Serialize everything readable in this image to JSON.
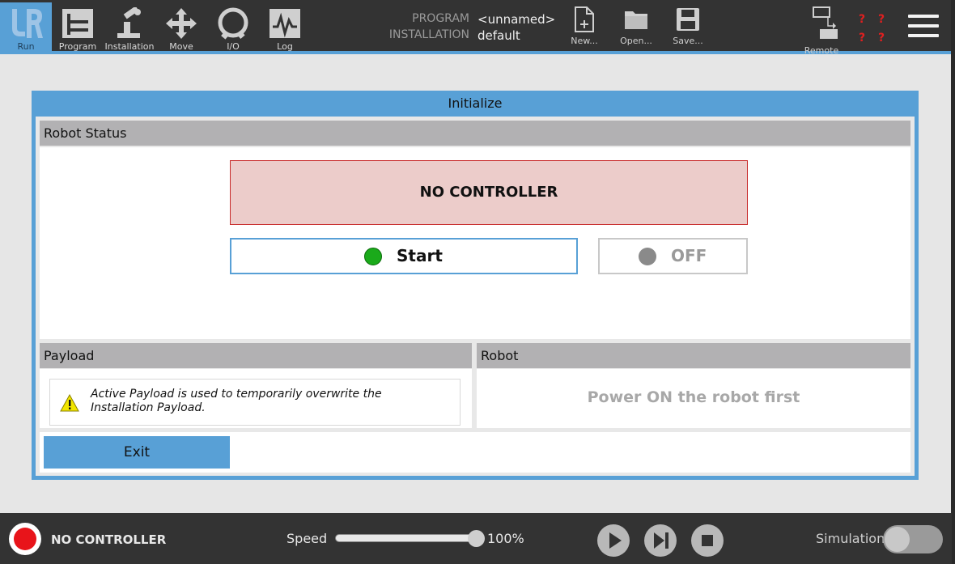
{
  "nav": {
    "items": [
      {
        "label": "Run"
      },
      {
        "label": "Program"
      },
      {
        "label": "Installation"
      },
      {
        "label": "Move"
      },
      {
        "label": "I/O"
      },
      {
        "label": "Log"
      }
    ],
    "active": "Run"
  },
  "header": {
    "program_label": "PROGRAM",
    "program_value": "<unnamed>",
    "installation_label": "INSTALLATION",
    "installation_value": "default",
    "new_label": "New...",
    "open_label": "Open...",
    "save_label": "Save...",
    "remote_label": "Remote",
    "unknown_marks": [
      "?",
      "?",
      "?",
      "?"
    ]
  },
  "dialog": {
    "title": "Initialize",
    "robot_status_header": "Robot Status",
    "controller_status": "NO CONTROLLER",
    "start_label": "Start",
    "off_label": "OFF",
    "payload_header": "Payload",
    "payload_note": "Active Payload is used to temporarily overwrite the Installation Payload.",
    "robot_header": "Robot",
    "robot_message": "Power ON the robot first",
    "exit_label": "Exit"
  },
  "footer": {
    "status_text": "NO CONTROLLER",
    "speed_label": "Speed",
    "speed_value": "100%",
    "speed_fraction": 1.0,
    "simulation_label": "Simulation",
    "simulation_on": false
  },
  "colors": {
    "accent": "#58a0d6",
    "topbar": "#333333",
    "status_red": "#e8141a",
    "start_green": "#1aaa1a",
    "off_grey": "#8a8a8a"
  }
}
